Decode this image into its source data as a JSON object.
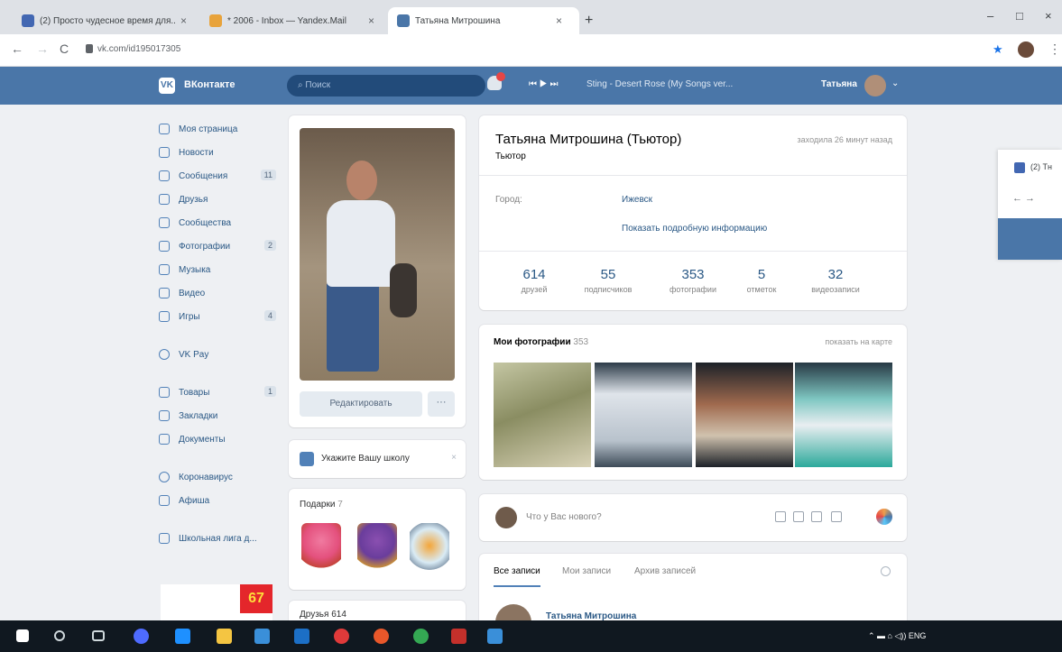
{
  "browser": {
    "tabs": [
      {
        "title": "(2) Просто чудесное время для...",
        "color": "#4267b2"
      },
      {
        "title": "* 2006 - Inbox — Yandex.Mail",
        "color": "#e8a33b"
      },
      {
        "title": "Татьяна Митрошина",
        "color": "#4a76a8"
      }
    ],
    "new_tab": "+",
    "window_controls": [
      "–",
      "□",
      "×"
    ],
    "nav": {
      "back": "←",
      "forward": "→",
      "reload": "C"
    },
    "url": "vk.com/id195017305",
    "star": "★",
    "menu": "⋮"
  },
  "vk": {
    "brand": "ВКонтакте",
    "logo": "VK",
    "search_placeholder": "Поиск",
    "player": {
      "controls": "⏮  ▶  ⏭",
      "track": "Sting - Desert Rose (My Songs ver..."
    },
    "user_name": "Татьяна",
    "chevron": "⌄"
  },
  "left_nav": {
    "items": [
      {
        "label": "Моя страница",
        "count": ""
      },
      {
        "label": "Новости",
        "count": ""
      },
      {
        "label": "Сообщения",
        "count": "11"
      },
      {
        "label": "Друзья",
        "count": ""
      },
      {
        "label": "Сообщества",
        "count": ""
      },
      {
        "label": "Фотографии",
        "count": "2"
      },
      {
        "label": "Музыка",
        "count": ""
      },
      {
        "label": "Видео",
        "count": ""
      },
      {
        "label": "Игры",
        "count": "4"
      }
    ],
    "pay": "VK Pay",
    "items2": [
      {
        "label": "Товары",
        "count": "1"
      },
      {
        "label": "Закладки",
        "count": ""
      },
      {
        "label": "Документы",
        "count": ""
      }
    ],
    "items3": [
      {
        "label": "Коронавирус"
      },
      {
        "label": "Афиша"
      }
    ],
    "items4": [
      {
        "label": "Школьная лига д..."
      }
    ]
  },
  "ad": {
    "badge": "67"
  },
  "profile": {
    "edit_label": "Редактировать",
    "more_label": "···",
    "school_prompt": "Укажите Вашу школу",
    "school_close": "×",
    "gifts_title": "Подарки",
    "gifts_count": "7",
    "friends_title": "Друзья 614",
    "name": "Татьяна Митрошина (Тьютор)",
    "status": "Тьютор",
    "online": "заходила 26 минут назад",
    "city_label": "Город:",
    "city_value": "Ижевск",
    "more_info": "Показать подробную информацию",
    "counters": [
      {
        "num": "614",
        "label": "друзей"
      },
      {
        "num": "55",
        "label": "подписчиков"
      },
      {
        "num": "353",
        "label": "фотографии"
      },
      {
        "num": "5",
        "label": "отметок"
      },
      {
        "num": "32",
        "label": "видеозаписи"
      }
    ]
  },
  "photos": {
    "title": "Мои фотографии",
    "count": "353",
    "map_link": "показать на карте"
  },
  "new_post": {
    "placeholder": "Что у Вас нового?"
  },
  "wall": {
    "tabs": [
      "Все записи",
      "Мои записи",
      "Архив записей"
    ],
    "author": "Татьяна Митрошина"
  },
  "side_popup": {
    "text": "(2) Тн",
    "nav": "←  →"
  },
  "taskbar": {
    "tray": "⌃  ▬  ⌂  ◁))  ENG",
    "icons": [
      "#1e90ff",
      "#5f6b78",
      "#5f6b78",
      "#4e6bff",
      "#1e90ff",
      "#f4c542",
      "#3a8fd9",
      "#1c6fc6",
      "#e03a3a",
      "#e8572a",
      "#34a853",
      "#c4302b",
      "#3a8fd9"
    ]
  }
}
